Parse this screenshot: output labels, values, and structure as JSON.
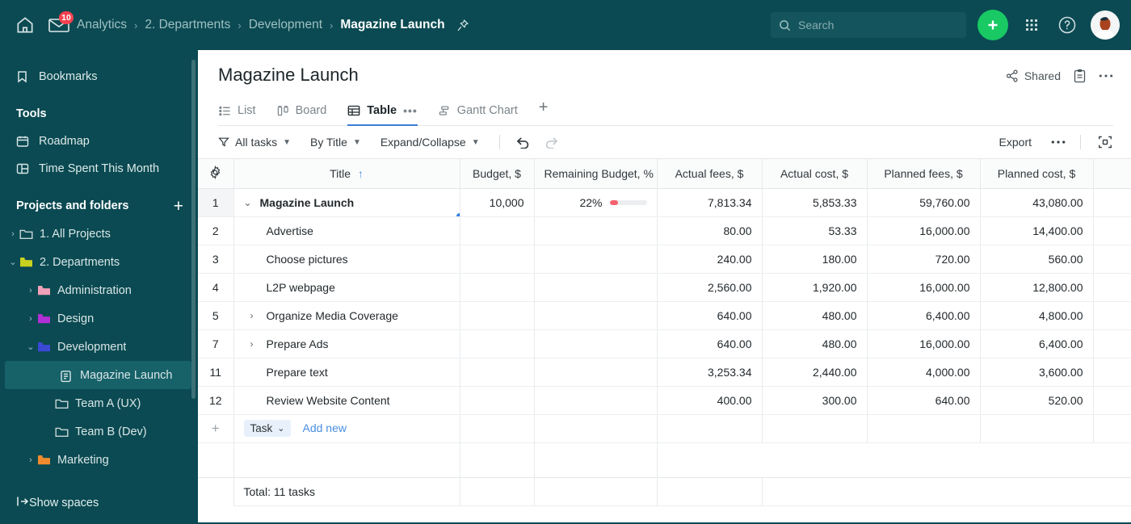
{
  "topbar": {
    "home_icon": "home-icon",
    "mail_icon": "mail-icon",
    "mail_badge": "10",
    "breadcrumbs": [
      {
        "label": "Analytics",
        "active": false
      },
      {
        "label": "2. Departments",
        "active": false
      },
      {
        "label": "Development",
        "active": false
      },
      {
        "label": "Magazine Launch",
        "active": true
      }
    ],
    "separator": "›",
    "pin_icon": "pin-icon",
    "search": {
      "placeholder": "Search",
      "value": "",
      "icon": "search-icon"
    },
    "create_button": {
      "icon": "plus-icon",
      "color": "#18c964"
    },
    "apps_icon": "grid-apps-icon",
    "help_icon": "help-circle-icon",
    "avatar": "user-avatar",
    "background_color": "#0b4a52"
  },
  "sidebar": {
    "bookmarks": {
      "label": "Bookmarks",
      "icon": "bookmark-icon"
    },
    "tools_heading": "Tools",
    "tools": [
      {
        "label": "Roadmap",
        "icon": "roadmap-calendar-icon"
      },
      {
        "label": "Time Spent This Month",
        "icon": "time-spent-grid-icon"
      }
    ],
    "projects_heading": "Projects and folders",
    "add_icon": "plus-icon",
    "tree": [
      {
        "label": "1. All Projects",
        "depth": 0,
        "caret": "collapsed",
        "icon": "folder-outline-icon",
        "color": "#c9d6d7",
        "selected": false
      },
      {
        "label": "2. Departments",
        "depth": 0,
        "caret": "expanded",
        "icon": "folder-icon",
        "color": "#c8d11f",
        "selected": false
      },
      {
        "label": "Administration",
        "depth": 1,
        "caret": "collapsed",
        "icon": "folder-icon",
        "color": "#f0a0b8",
        "selected": false
      },
      {
        "label": "Design",
        "depth": 1,
        "caret": "collapsed",
        "icon": "folder-icon",
        "color": "#b12fd6",
        "selected": false
      },
      {
        "label": "Development",
        "depth": 1,
        "caret": "expanded",
        "icon": "folder-icon",
        "color": "#3b49d6",
        "selected": false
      },
      {
        "label": "Magazine Launch",
        "depth": 2,
        "caret": "none",
        "icon": "project-doc-icon",
        "color": "#d8e6e7",
        "selected": true
      },
      {
        "label": "Team A (UX)",
        "depth": 2,
        "caret": "none",
        "icon": "folder-outline-icon",
        "color": "#c9d6d7",
        "selected": false
      },
      {
        "label": "Team B (Dev)",
        "depth": 2,
        "caret": "none",
        "icon": "folder-outline-icon",
        "color": "#c9d6d7",
        "selected": false
      },
      {
        "label": "Marketing",
        "depth": 1,
        "caret": "collapsed",
        "icon": "folder-icon",
        "color": "#ef8b2c",
        "selected": false
      }
    ],
    "footer": {
      "label": "Show spaces",
      "icon": "expand-panel-icon"
    }
  },
  "main": {
    "title": "Magazine Launch",
    "head_actions": [
      {
        "label": "Shared",
        "icon": "share-icon"
      },
      {
        "label": "",
        "icon": "clipboard-icon"
      },
      {
        "label": "",
        "icon": "more-horizontal-icon"
      }
    ],
    "tabs": [
      {
        "label": "List",
        "icon": "list-icon",
        "active": false
      },
      {
        "label": "Board",
        "icon": "board-icon",
        "active": false
      },
      {
        "label": "Table",
        "icon": "table-icon",
        "active": true,
        "dots": "•••"
      },
      {
        "label": "Gantt Chart",
        "icon": "gantt-icon",
        "active": false
      }
    ],
    "tab_add": "+",
    "toolbar": {
      "left": [
        {
          "label": "All tasks",
          "icon": "filter-icon",
          "chevron": true
        },
        {
          "label": "By Title",
          "icon": "",
          "chevron": true
        },
        {
          "label": "Expand/Collapse",
          "icon": "",
          "chevron": true
        }
      ],
      "undo_icon": "undo-icon",
      "redo_icon": "redo-icon",
      "export_label": "Export",
      "more_icon": "more-horizontal-icon",
      "fullscreen_icon": "fullscreen-icon"
    }
  },
  "table": {
    "gear_icon": "settings-gear-icon",
    "add_column_icon": "plus-icon",
    "columns": [
      {
        "key": "title",
        "label": "Title",
        "sort": "↑"
      },
      {
        "key": "budget",
        "label": "Budget, $"
      },
      {
        "key": "remaining",
        "label": "Remaining Budget, %"
      },
      {
        "key": "actual_fees",
        "label": "Actual fees, $"
      },
      {
        "key": "actual_cost",
        "label": "Actual cost, $"
      },
      {
        "key": "planned_fees",
        "label": "Planned fees, $"
      },
      {
        "key": "planned_cost",
        "label": "Planned cost, $"
      }
    ],
    "rows": [
      {
        "num": "1",
        "title": "Magazine Launch",
        "depth": 0,
        "caret": "expanded",
        "bold": true,
        "selected": true,
        "budget": "10,000",
        "remaining": "22%",
        "remaining_pct": 22,
        "actual_fees": "7,813.34",
        "actual_cost": "5,853.33",
        "planned_fees": "59,760.00",
        "planned_cost": "43,080.00"
      },
      {
        "num": "2",
        "title": "Advertise",
        "depth": 1,
        "caret": "none",
        "bold": false,
        "selected": false,
        "budget": "",
        "remaining": "",
        "remaining_pct": null,
        "actual_fees": "80.00",
        "actual_cost": "53.33",
        "planned_fees": "16,000.00",
        "planned_cost": "14,400.00"
      },
      {
        "num": "3",
        "title": "Choose pictures",
        "depth": 1,
        "caret": "none",
        "bold": false,
        "selected": false,
        "budget": "",
        "remaining": "",
        "remaining_pct": null,
        "actual_fees": "240.00",
        "actual_cost": "180.00",
        "planned_fees": "720.00",
        "planned_cost": "560.00"
      },
      {
        "num": "4",
        "title": "L2P webpage",
        "depth": 1,
        "caret": "none",
        "bold": false,
        "selected": false,
        "budget": "",
        "remaining": "",
        "remaining_pct": null,
        "actual_fees": "2,560.00",
        "actual_cost": "1,920.00",
        "planned_fees": "16,000.00",
        "planned_cost": "12,800.00"
      },
      {
        "num": "5",
        "title": "Organize Media Coverage",
        "depth": 1,
        "caret": "collapsed",
        "bold": false,
        "selected": false,
        "budget": "",
        "remaining": "",
        "remaining_pct": null,
        "actual_fees": "640.00",
        "actual_cost": "480.00",
        "planned_fees": "6,400.00",
        "planned_cost": "4,800.00"
      },
      {
        "num": "7",
        "title": "Prepare Ads",
        "depth": 1,
        "caret": "collapsed",
        "bold": false,
        "selected": false,
        "budget": "",
        "remaining": "",
        "remaining_pct": null,
        "actual_fees": "640.00",
        "actual_cost": "480.00",
        "planned_fees": "16,000.00",
        "planned_cost": "6,400.00"
      },
      {
        "num": "11",
        "title": "Prepare text",
        "depth": 1,
        "caret": "none",
        "bold": false,
        "selected": false,
        "budget": "",
        "remaining": "",
        "remaining_pct": null,
        "actual_fees": "3,253.34",
        "actual_cost": "2,440.00",
        "planned_fees": "4,000.00",
        "planned_cost": "3,600.00"
      },
      {
        "num": "12",
        "title": "Review Website Content",
        "depth": 1,
        "caret": "none",
        "bold": false,
        "selected": false,
        "budget": "",
        "remaining": "",
        "remaining_pct": null,
        "actual_fees": "400.00",
        "actual_cost": "300.00",
        "planned_fees": "640.00",
        "planned_cost": "520.00"
      }
    ],
    "add_row": {
      "num": "+",
      "type_label": "Task",
      "chevron": "⌄",
      "add_new_label": "Add new"
    },
    "total_label": "Total: 11 tasks"
  },
  "colors": {
    "brand_dark": "#0b4a52",
    "accent_green": "#18c964",
    "accent_blue": "#4a8fe0",
    "progress_red": "#f5616f",
    "badge_red": "#f5414f"
  }
}
